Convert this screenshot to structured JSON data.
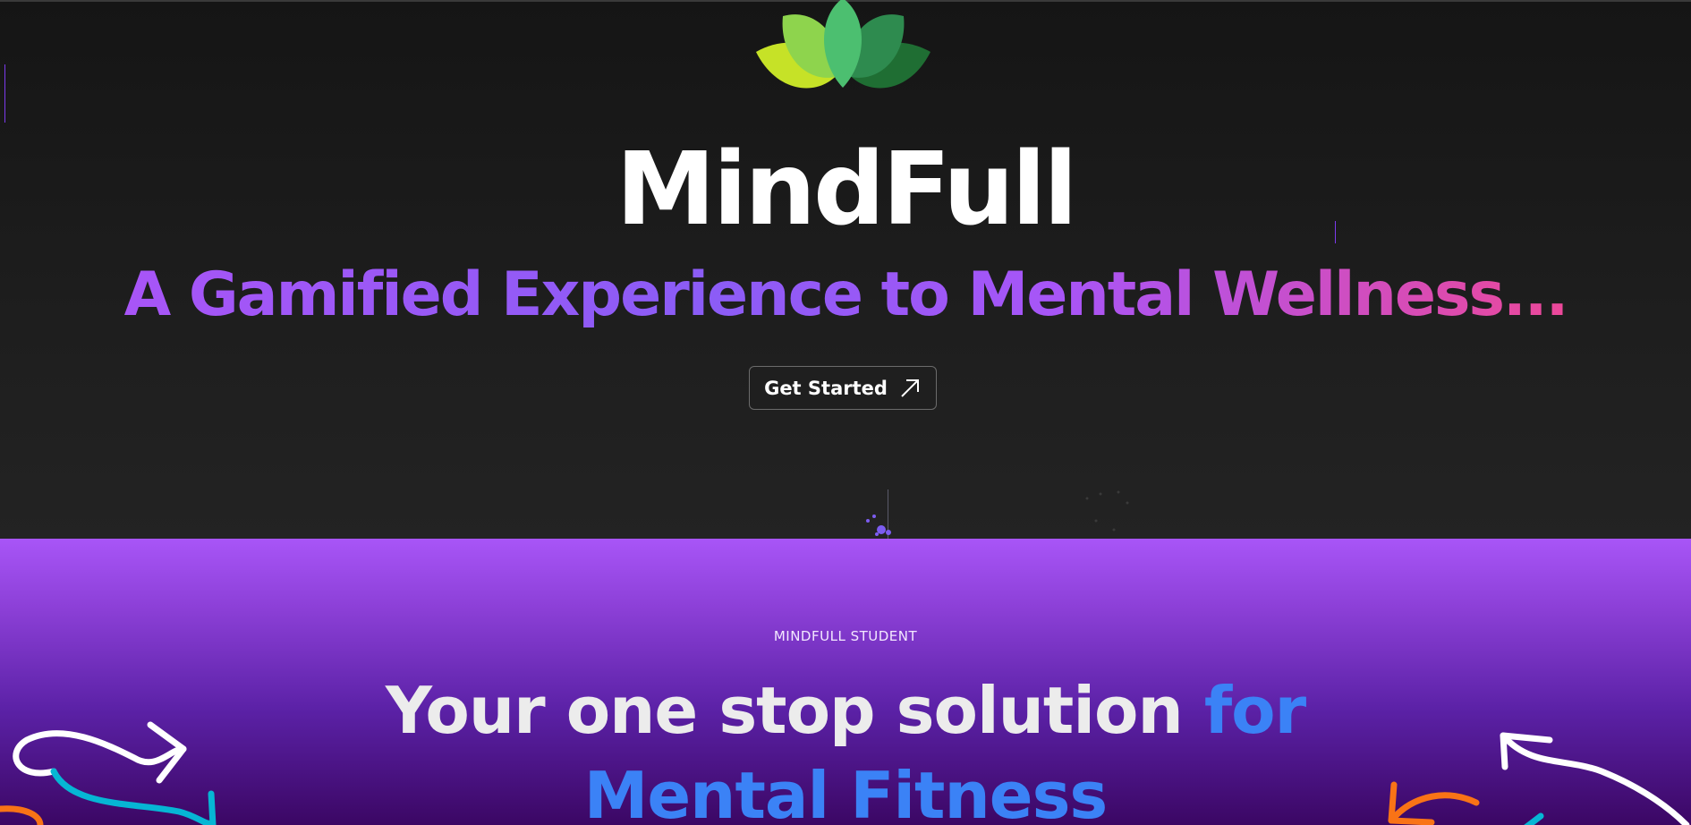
{
  "hero": {
    "logo_icon": "lotus-logo",
    "title": "MindFull",
    "tagline": "A Gamified Experience to Mental Wellness...",
    "cta_label": "Get Started",
    "cta_icon": "arrow-up-right-icon"
  },
  "intro": {
    "eyebrow": "MINDFULL STUDENT",
    "headline_part1": "Your one stop solution ",
    "headline_accent1": "for",
    "headline_accent2": "Mental Fitness"
  },
  "colors": {
    "hero_bg": "#1b1b1b",
    "tagline_start": "#a855f7",
    "tagline_end": "#ec4899",
    "section_top": "#a855f7",
    "section_bottom": "#3b0764",
    "accent_blue": "#3b82f6"
  }
}
